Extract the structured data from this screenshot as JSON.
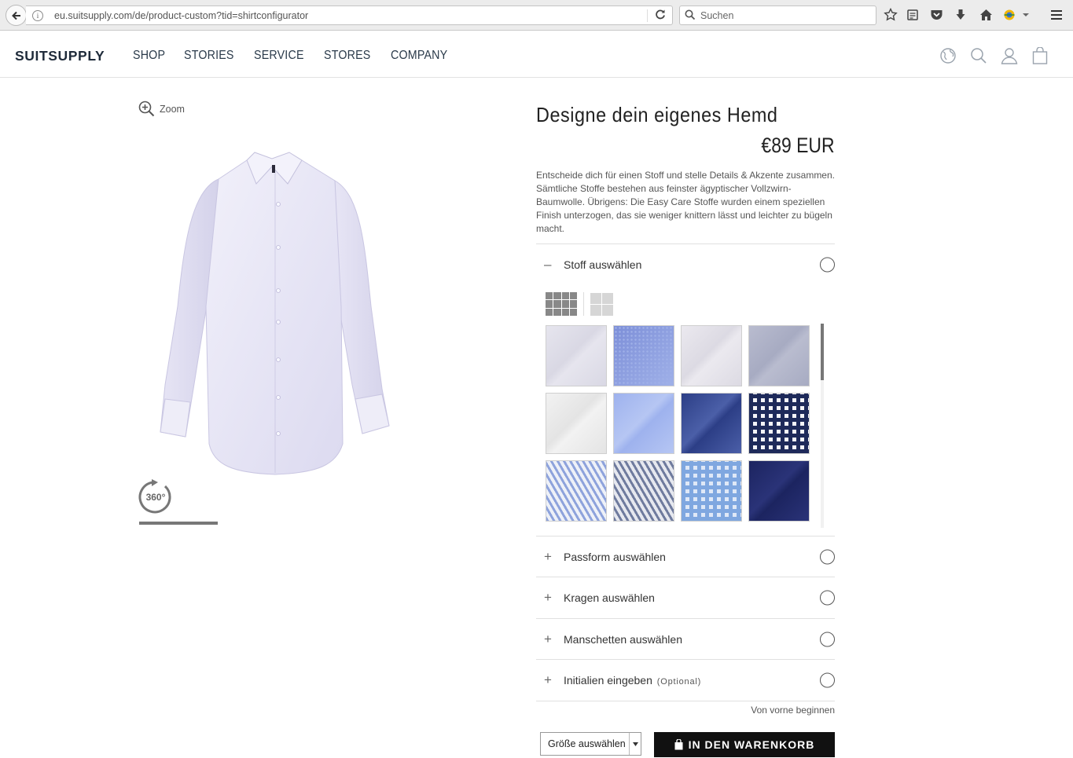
{
  "browser": {
    "url": "eu.suitsupply.com/de/product-custom?tid=shirtconfigurator",
    "search_placeholder": "Suchen"
  },
  "header": {
    "logo": "SUITSUPPLY",
    "nav": [
      "SHOP",
      "STORIES",
      "SERVICE",
      "STORES",
      "COMPANY"
    ]
  },
  "product": {
    "zoom_label": "Zoom",
    "rotate_label": "360°",
    "title": "Designe dein eigenes Hemd",
    "price": "€89 EUR",
    "description": "Entscheide dich für einen Stoff und stelle Details & Akzente zusammen. Sämtliche Stoffe bestehen aus feinster ägyptischer Vollzwirn-Baumwolle. Übrigens: Die Easy Care Stoffe wurden einem speziellen Finish unterzogen, das sie weniger knittern lässt und leichter zu bügeln macht."
  },
  "sections": [
    {
      "symbol": "–",
      "label": "Stoff auswählen"
    },
    {
      "symbol": "+",
      "label": "Passform auswählen"
    },
    {
      "symbol": "+",
      "label": "Kragen auswählen"
    },
    {
      "symbol": "+",
      "label": "Manschetten auswählen"
    },
    {
      "symbol": "+",
      "label": "Initialien eingeben",
      "optional": "(Optional)"
    }
  ],
  "fabrics": [
    {
      "name": "light-lavender-twill",
      "colors": [
        "#e6e5ee",
        "#d9d8e4"
      ]
    },
    {
      "name": "blue-dot",
      "colors": [
        "#7d8fd8",
        "#9fb0e8"
      ]
    },
    {
      "name": "white-lilac-twill",
      "colors": [
        "#ebe9ef",
        "#dcdae3"
      ]
    },
    {
      "name": "lavender-grey",
      "colors": [
        "#b9bccf",
        "#a7abc2"
      ]
    },
    {
      "name": "white-linen",
      "colors": [
        "#f2f2f2",
        "#e4e4e4"
      ]
    },
    {
      "name": "light-blue-linen",
      "colors": [
        "#9eb2ee",
        "#b6c6f3"
      ]
    },
    {
      "name": "navy-melange",
      "colors": [
        "#2c3e86",
        "#4b5fa8"
      ]
    },
    {
      "name": "navy-gingham",
      "colors": [
        "#1e2a5a",
        "#f4f4f8"
      ]
    },
    {
      "name": "blue-stripe",
      "colors": [
        "#8ea3dc",
        "#eef1f8"
      ]
    },
    {
      "name": "grey-blue-stripe",
      "colors": [
        "#6f7b9e",
        "#e6e8ef"
      ]
    },
    {
      "name": "light-blue-check",
      "colors": [
        "#7fa7e0",
        "#dfe8f7"
      ]
    },
    {
      "name": "navy-solid",
      "colors": [
        "#1c2460",
        "#2a3378"
      ]
    }
  ],
  "actions": {
    "restart": "Von vorne beginnen",
    "size_select": "Größe auswählen",
    "cart": "IN DEN WARENKORB"
  }
}
